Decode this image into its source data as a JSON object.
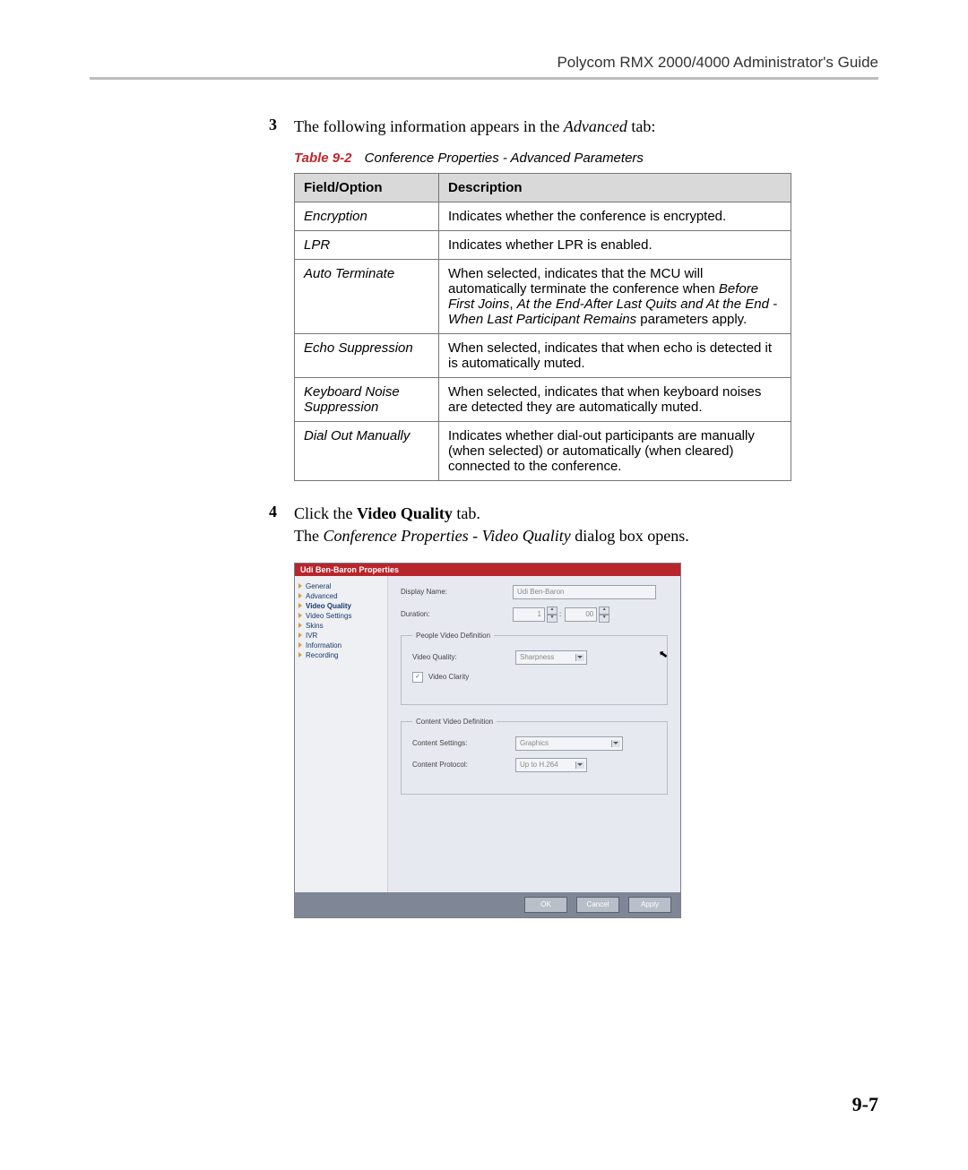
{
  "header": {
    "guide_title": "Polycom RMX 2000/4000 Administrator's Guide"
  },
  "step3": {
    "num": "3",
    "text_prefix": "The following information appears in the ",
    "text_italic": "Advanced",
    "text_suffix": " tab:"
  },
  "table": {
    "caption_label": "Table 9-2",
    "caption_text": "Conference Properties - Advanced Parameters",
    "col1": "Field/Option",
    "col2": "Description",
    "rows": [
      {
        "field": "Encryption",
        "desc": "Indicates whether the conference is encrypted."
      },
      {
        "field": "LPR",
        "desc": "Indicates whether LPR is enabled."
      },
      {
        "field": "Auto Terminate",
        "desc_pre": "When selected, indicates that the MCU will automatically terminate the conference when ",
        "desc_i1": "Before First Joins",
        "desc_mid1": ", ",
        "desc_i2": "At the End-After Last Quits and At the End - When Last Participant Remains",
        "desc_post": " parameters apply."
      },
      {
        "field": "Echo Suppression",
        "desc": "When selected, indicates that when echo is detected it is automatically muted."
      },
      {
        "field": "Keyboard Noise Suppression",
        "desc": "When selected, indicates that when keyboard noises are detected they are automatically muted."
      },
      {
        "field": "Dial Out Manually",
        "desc": "Indicates whether dial-out participants are manually (when selected) or automatically (when cleared) connected to the conference."
      }
    ]
  },
  "step4": {
    "num": "4",
    "line1_pre": "Click the ",
    "line1_bold": "Video Quality",
    "line1_post": " tab.",
    "line2_pre": "The ",
    "line2_italic": "Conference Properties - Video Quality",
    "line2_post": " dialog box opens."
  },
  "dialog": {
    "title": "Udi Ben-Baron Properties",
    "sidebar": {
      "items": [
        {
          "label": "General"
        },
        {
          "label": "Advanced"
        },
        {
          "label": "Video Quality"
        },
        {
          "label": "Video Settings"
        },
        {
          "label": "Skins"
        },
        {
          "label": "IVR"
        },
        {
          "label": "Information"
        },
        {
          "label": "Recording"
        }
      ]
    },
    "display_name_label": "Display Name:",
    "display_name_value": "Udi Ben-Baron",
    "duration_label": "Duration:",
    "duration_h": "1",
    "duration_sep": ":",
    "duration_m": "00",
    "group1": {
      "legend": "People Video Definition",
      "video_quality_label": "Video Quality:",
      "video_quality_value": "Sharpness",
      "video_clarity_label": "Video Clarity",
      "video_clarity_checked": "✓"
    },
    "group2": {
      "legend": "Content Video Definition",
      "content_settings_label": "Content Settings:",
      "content_settings_value": "Graphics",
      "content_protocol_label": "Content Protocol:",
      "content_protocol_value": "Up to H.264"
    },
    "buttons": {
      "ok": "OK",
      "cancel": "Cancel",
      "apply": "Apply"
    }
  },
  "page_number": "9-7"
}
